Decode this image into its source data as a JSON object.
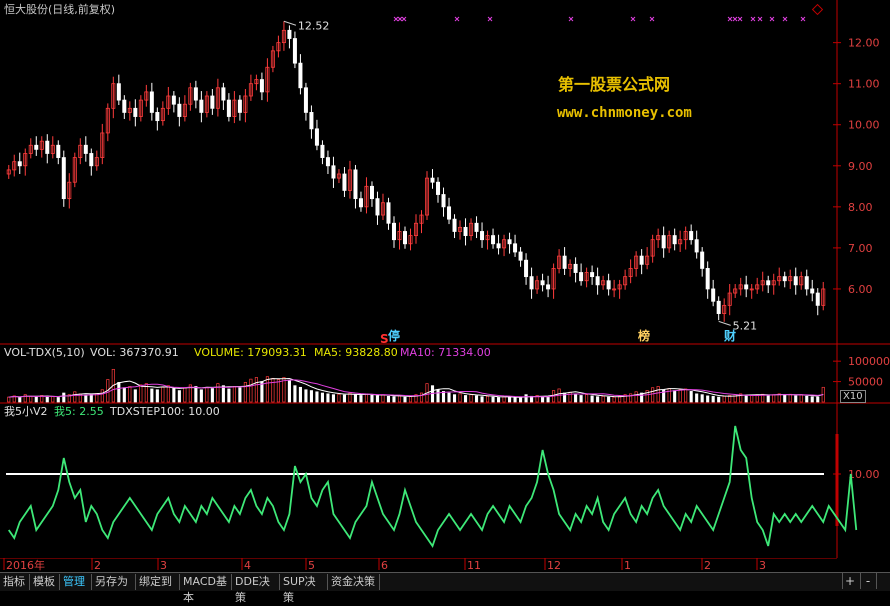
{
  "title": "恒大股份(日线,前复权)",
  "watermark": {
    "line1": "第一股票公式网",
    "line2": "www.chnmoney.com"
  },
  "price_panel": {
    "high_label": "12.52",
    "low_label": "5.21",
    "markers": [
      {
        "text": "S",
        "color": "#ff3030"
      },
      {
        "text": "停",
        "color": "#4fd0ff"
      },
      {
        "text": "榜",
        "color": "#ffd060"
      },
      {
        "text": "财",
        "color": "#4fd0ff"
      }
    ]
  },
  "vol_panel": {
    "name": "VOL-TDX(5,10)",
    "vol": "VOL: 367370.91",
    "volume": "VOLUME: 179093.31",
    "ma5": "MA5: 93828.80",
    "ma10": "MA10: 71334.00",
    "scale": "X10"
  },
  "osc_panel": {
    "name": "我5小V2",
    "w5": "我5: 2.55",
    "step": "TDXSTEP100: 10.00"
  },
  "tabs": [
    "指标",
    "模板",
    "管理",
    "另存为",
    "绑定到",
    "MACD基本",
    "DDE决策",
    "SUP决策",
    "资金决策"
  ],
  "active_tab": "管理",
  "controls": [
    "+",
    "-"
  ],
  "colors": {
    "up": "#ff3c3c",
    "down": "#ffffff",
    "osc": "#3ee878",
    "ma10": "#e040e0",
    "axis": "#c00000"
  },
  "chart_data": [
    {
      "type": "candlestick",
      "title": "恒大股份(日线,前复权)",
      "ylim": [
        5.0,
        12.6
      ],
      "y_ticks": [
        6.0,
        7.0,
        8.0,
        9.0,
        10.0,
        11.0,
        12.0
      ],
      "x_ticks": [
        "2016年",
        "2",
        "3",
        "4",
        "5",
        "6",
        "11",
        "12",
        "1",
        "2",
        "3"
      ],
      "annotations": [
        {
          "text": "12.52",
          "type": "high"
        },
        {
          "text": "5.21",
          "type": "low"
        }
      ],
      "close": [
        8.9,
        9.1,
        9.0,
        9.3,
        9.5,
        9.4,
        9.6,
        9.3,
        9.5,
        9.2,
        8.2,
        8.6,
        9.2,
        9.5,
        9.3,
        9.0,
        9.2,
        9.8,
        10.4,
        11.0,
        10.6,
        10.3,
        10.4,
        10.2,
        10.6,
        10.8,
        10.3,
        10.1,
        10.4,
        10.7,
        10.5,
        10.2,
        10.5,
        10.9,
        10.6,
        10.3,
        10.7,
        10.4,
        10.9,
        10.6,
        10.2,
        10.6,
        10.3,
        10.7,
        11.0,
        11.1,
        10.8,
        11.4,
        11.8,
        12.0,
        12.3,
        12.1,
        11.5,
        10.9,
        10.3,
        9.9,
        9.5,
        9.2,
        9.0,
        8.7,
        8.8,
        8.4,
        8.9,
        8.2,
        8.0,
        8.5,
        8.2,
        7.8,
        8.1,
        7.6,
        7.2,
        7.4,
        7.1,
        7.3,
        7.6,
        7.8,
        8.7,
        8.6,
        8.3,
        8.0,
        7.7,
        7.4,
        7.5,
        7.3,
        7.6,
        7.4,
        7.2,
        7.3,
        7.1,
        7.0,
        7.2,
        7.1,
        6.9,
        6.7,
        6.3,
        6.0,
        6.2,
        6.1,
        6.0,
        6.5,
        6.8,
        6.5,
        6.6,
        6.4,
        6.2,
        6.4,
        6.3,
        6.1,
        6.2,
        6.0,
        6.0,
        6.1,
        6.3,
        6.5,
        6.8,
        6.6,
        6.8,
        7.2,
        7.3,
        7.0,
        7.3,
        7.1,
        7.2,
        7.4,
        7.2,
        6.9,
        6.5,
        6.0,
        5.7,
        5.4,
        5.6,
        5.9,
        6.0,
        6.1,
        6.0,
        6.0,
        6.1,
        6.2,
        6.1,
        6.2,
        6.3,
        6.2,
        6.3,
        6.1,
        6.3,
        6.0,
        5.9,
        5.6,
        6.0
      ]
    },
    {
      "type": "bar",
      "title": "VOL-TDX(5,10)",
      "y_ticks": [
        50000,
        100000
      ],
      "series": [
        {
          "name": "MA5",
          "value": 93828.8
        },
        {
          "name": "MA10",
          "value": 71334.0
        }
      ],
      "vol": 367370.91,
      "volume": 179093.31,
      "values": [
        12000,
        15000,
        11000,
        18000,
        14000,
        13000,
        16000,
        12000,
        14000,
        11000,
        22000,
        18000,
        25000,
        20000,
        17000,
        19000,
        21000,
        30000,
        55000,
        80000,
        48000,
        35000,
        38000,
        30000,
        42000,
        45000,
        32000,
        30000,
        36000,
        40000,
        33000,
        28000,
        35000,
        42000,
        38000,
        30000,
        36000,
        33000,
        45000,
        40000,
        32000,
        38000,
        35000,
        48000,
        56000,
        60000,
        50000,
        62000,
        58000,
        55000,
        60000,
        52000,
        40000,
        36000,
        30000,
        28000,
        25000,
        22000,
        20000,
        18000,
        19000,
        17000,
        22000,
        18000,
        16000,
        20000,
        17000,
        15000,
        18000,
        14000,
        13000,
        15000,
        12000,
        14000,
        18000,
        22000,
        45000,
        40000,
        30000,
        26000,
        22000,
        18000,
        20000,
        16000,
        18000,
        15000,
        13000,
        14000,
        12000,
        11000,
        13000,
        12000,
        11000,
        10000,
        18000,
        14000,
        16000,
        13000,
        12000,
        28000,
        32000,
        22000,
        24000,
        20000,
        16000,
        18000,
        15000,
        13000,
        14000,
        12000,
        12000,
        14000,
        18000,
        20000,
        25000,
        22000,
        28000,
        35000,
        38000,
        30000,
        33000,
        28000,
        30000,
        32000,
        26000,
        20000,
        18000,
        15000,
        14000,
        12000,
        14000,
        16000,
        18000,
        20000,
        17000,
        16000,
        18000,
        19000,
        17000,
        18000,
        20000,
        17000,
        19000,
        15000,
        18000,
        14000,
        13000,
        12000,
        36000
      ]
    },
    {
      "type": "line",
      "title": "我5小V2",
      "y_ticks": [
        10.0
      ],
      "series": [
        {
          "name": "我5",
          "last": 2.55
        },
        {
          "name": "TDXSTEP100",
          "last": 10.0
        }
      ],
      "values": [
        3,
        2,
        4,
        5,
        6,
        3,
        4,
        5,
        6,
        8,
        12,
        9,
        7,
        8,
        4,
        6,
        5,
        3,
        2,
        4,
        5,
        6,
        7,
        6,
        5,
        4,
        3,
        5,
        6,
        7,
        5,
        4,
        6,
        5,
        4,
        6,
        5,
        7,
        6,
        5,
        4,
        6,
        5,
        7,
        8,
        6,
        5,
        7,
        6,
        4,
        3,
        5,
        11,
        9,
        10,
        7,
        6,
        8,
        9,
        5,
        4,
        3,
        2,
        4,
        5,
        6,
        9,
        7,
        5,
        4,
        3,
        5,
        8,
        6,
        4,
        3,
        2,
        1,
        3,
        4,
        5,
        4,
        3,
        4,
        5,
        4,
        3,
        5,
        6,
        5,
        4,
        6,
        5,
        4,
        6,
        7,
        9,
        13,
        10,
        8,
        5,
        4,
        3,
        5,
        4,
        6,
        5,
        7,
        4,
        3,
        5,
        6,
        7,
        5,
        4,
        6,
        5,
        7,
        8,
        6,
        5,
        4,
        3,
        5,
        4,
        6,
        5,
        4,
        3,
        5,
        7,
        9,
        16,
        13,
        12,
        7,
        4,
        3,
        1,
        5,
        4,
        5,
        4,
        5,
        4,
        5,
        6,
        5,
        4,
        6,
        5,
        4,
        3,
        10,
        3
      ]
    }
  ]
}
